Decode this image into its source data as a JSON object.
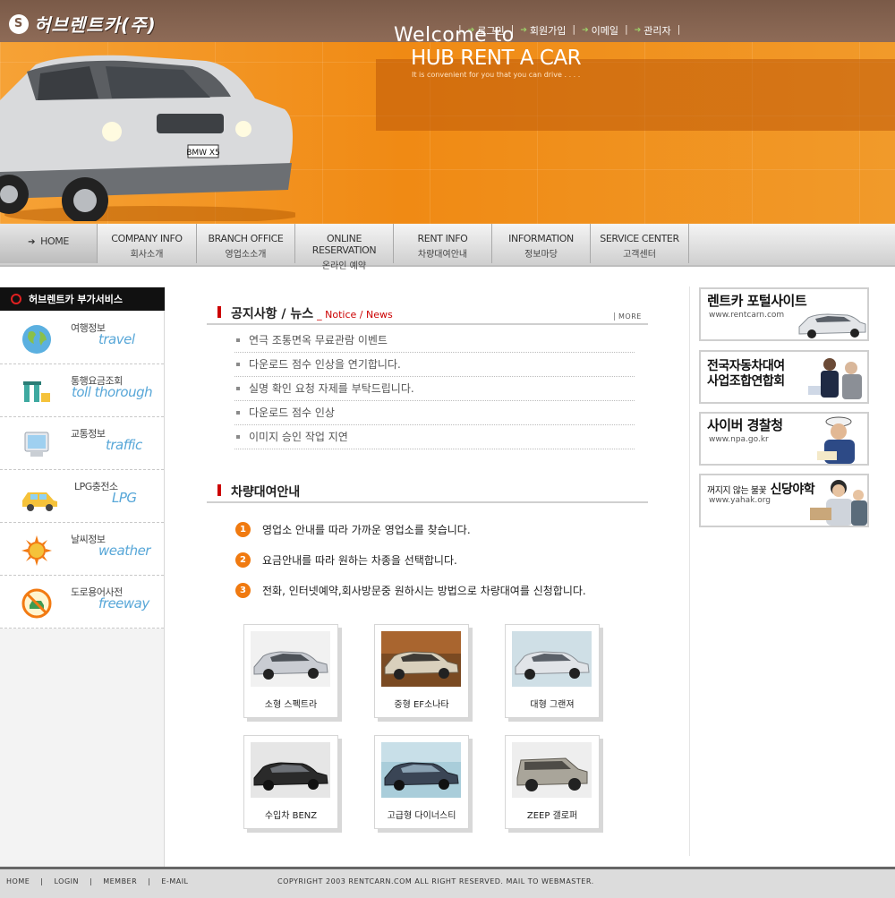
{
  "header": {
    "logo_text": "허브렌트카(주)",
    "top_nav": [
      "로그인",
      "회원가입",
      "이메일",
      "관리자"
    ]
  },
  "hero": {
    "welcome": "Welcome to",
    "title": "HUB RENT A CAR",
    "tagline": "It is convenient for you that you can drive . . . .",
    "plate": "BMW X5"
  },
  "main_nav": [
    {
      "en": "HOME",
      "ko": ""
    },
    {
      "en": "COMPANY INFO",
      "ko": "회사소개"
    },
    {
      "en": "BRANCH OFFICE",
      "ko": "영업소소개"
    },
    {
      "en": "ONLINE RESERVATION",
      "ko": "온라인 예약"
    },
    {
      "en": "RENT INFO",
      "ko": "차량대여안내"
    },
    {
      "en": "INFORMATION",
      "ko": "정보마당"
    },
    {
      "en": "SERVICE CENTER",
      "ko": "고객센터"
    }
  ],
  "sidebar": {
    "title": "허브렌트카 부가서비스",
    "items": [
      {
        "ko": "여행정보",
        "en": "travel",
        "icon": "globe-icon"
      },
      {
        "ko": "통행요금조회",
        "en": "toll thorough",
        "icon": "toll-gate-icon"
      },
      {
        "ko": "교통정보",
        "en": "traffic",
        "icon": "monitor-icon"
      },
      {
        "ko": "LPG충전소",
        "en": "LPG",
        "icon": "car-icon"
      },
      {
        "ko": "날씨정보",
        "en": "weather",
        "icon": "sun-icon"
      },
      {
        "ko": "도로용어사전",
        "en": "freeway",
        "icon": "no-car-icon"
      }
    ]
  },
  "notice": {
    "title": "공지사항 / 뉴스",
    "subtitle": "_ Notice / News",
    "more": "MORE",
    "items": [
      "연극 조통면옥 무료관람 이벤트",
      "다운로드 점수 인상을 연기합니다.",
      "실명 확인 요청 자제를 부탁드립니다.",
      "다운로드 점수 인상",
      "이미지 승인 작업 지연"
    ]
  },
  "rental": {
    "title": "차량대여안내",
    "steps": [
      "영업소 안내를 따라 가까운 영업소를 찾습니다.",
      "요금안내를 따라 원하는 차종을 선택합니다.",
      "전화, 인터넷예약,회사방문중 원하시는 방법으로 차량대여를 신청합니다."
    ],
    "step_numbers": [
      "1",
      "2",
      "3"
    ],
    "cars": [
      {
        "label": "소형 스펙트라",
        "color": "#c9ccd2",
        "bg": "#f4f4f4"
      },
      {
        "label": "중형 EF소나타",
        "color": "#d9d0bc",
        "bg": "#7a4a22"
      },
      {
        "label": "대형 그랜져",
        "color": "#e1e4e8",
        "bg": "#cfdfe6"
      },
      {
        "label": "수입차 BENZ",
        "color": "#2a2a2a",
        "bg": "#e6e6e6"
      },
      {
        "label": "고급형 다이너스티",
        "color": "#3a4555",
        "bg": "#a9cdda"
      },
      {
        "label": "ZEEP 갤로퍼",
        "color": "#a9a59a",
        "bg": "#eeeeee"
      }
    ]
  },
  "banners": [
    {
      "title": "렌트카 포털사이트",
      "url": "www.rentcarn.com",
      "icon": "car-banner-icon"
    },
    {
      "title": "전국자동차대여\n사업조합연합회",
      "url": "",
      "icon": "business-people-icon"
    },
    {
      "title": "사이버 경찰청",
      "url": "www.npa.go.kr",
      "icon": "police-officer-icon"
    },
    {
      "title_small": "꺼지지 않는 불꽃",
      "title": "신당야학",
      "url": "www.yahak.org",
      "icon": "student-reading-icon"
    }
  ],
  "footer": {
    "nav": [
      "HOME",
      "LOGIN",
      "MEMBER",
      "E-MAIL"
    ],
    "copyright": "COPYRIGHT 2003 RENTCARN.COM ALL RIGHT RESERVED. MAIL TO WEBMASTER."
  },
  "colors": {
    "brand_orange": "#f08a14",
    "header_brown": "#7a5a48",
    "accent_red": "#cc0000",
    "sidebar_blue": "#58a7d8"
  }
}
